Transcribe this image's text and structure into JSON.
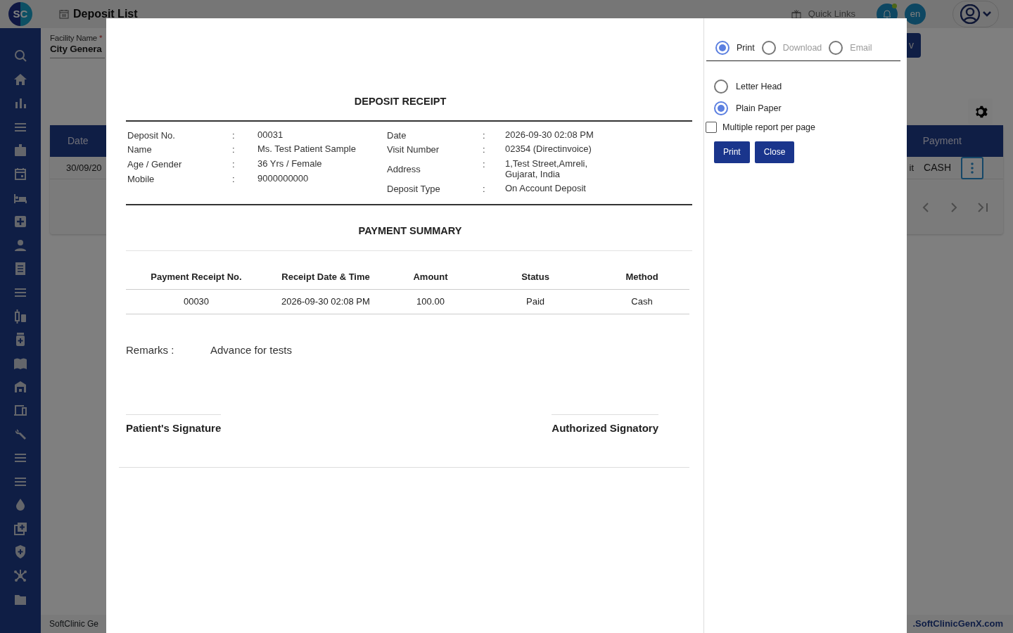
{
  "app": {
    "logo": {
      "left": "S",
      "right": "C"
    },
    "page_title": "Deposit List",
    "quick_links": "Quick Links",
    "notification_unread": true,
    "language": "en",
    "filter": {
      "label": "Facility Name",
      "required_mark": "*",
      "value": "City Genera"
    },
    "top_button_fragment": "v",
    "table": {
      "columns": [
        "Date",
        "Payment"
      ],
      "row": {
        "date": "30/09/20",
        "fragment": "it",
        "payment": "CASH"
      }
    },
    "footer": {
      "left": "SoftClinic Ge",
      "right": ".SoftClinicGenX.com"
    }
  },
  "receipt": {
    "title": "DEPOSIT RECEIPT",
    "left_fields": [
      {
        "label": "Deposit No.",
        "value": "00031"
      },
      {
        "label": "Name",
        "value": "Ms. Test Patient Sample"
      },
      {
        "label": "Age / Gender",
        "value": "36 Yrs / Female"
      },
      {
        "label": "Mobile",
        "value": "9000000000"
      }
    ],
    "right_fields": [
      {
        "label": "Date",
        "value": "2026-09-30 02:08 PM"
      },
      {
        "label": "Visit Number",
        "value": "02354 (Directinvoice)"
      },
      {
        "label": "Address",
        "value": "1,Test Street,Amreli,\nGujarat, India"
      },
      {
        "label": "Deposit Type",
        "value": "On Account Deposit"
      }
    ],
    "separator": ":",
    "summary_title": "PAYMENT SUMMARY",
    "columns": [
      "Payment Receipt No.",
      "Receipt Date & Time",
      "Amount",
      "Status",
      "Method"
    ],
    "rows": [
      [
        "00030",
        "2026-09-30 02:08 PM",
        "100.00",
        "Paid",
        "Cash"
      ]
    ],
    "remarks_label": "Remarks :",
    "remarks": "Advance for tests",
    "signatures": [
      "Patient's Signature",
      "Authorized Signatory"
    ]
  },
  "print_options": {
    "modes": [
      {
        "label": "Print",
        "selected": true
      },
      {
        "label": "Download",
        "selected": false
      },
      {
        "label": "Email",
        "selected": false
      }
    ],
    "paper": [
      {
        "label": "Letter Head",
        "selected": false
      },
      {
        "label": "Plain Paper",
        "selected": true
      }
    ],
    "multiple": {
      "label": "Multiple report per page",
      "checked": false
    },
    "buttons": [
      "Print",
      "Close"
    ]
  }
}
